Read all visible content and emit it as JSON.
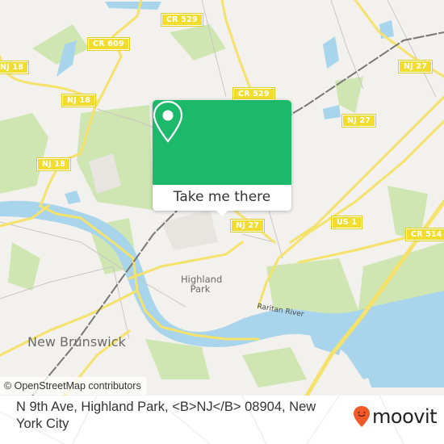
{
  "map": {
    "attribution": "© OpenStreetMap contributors",
    "road_shields": [
      {
        "id": "cr529-top",
        "label": "CR 529"
      },
      {
        "id": "cr609",
        "label": "CR 609"
      },
      {
        "id": "nj27-top",
        "label": "NJ 27"
      },
      {
        "id": "nj18-left",
        "label": "NJ 18"
      },
      {
        "id": "nj18-mid",
        "label": "NJ 18"
      },
      {
        "id": "cr529-mid",
        "label": "CR 529"
      },
      {
        "id": "nj27-mid",
        "label": "NJ 27"
      },
      {
        "id": "nj18-low",
        "label": "NJ 18"
      },
      {
        "id": "nj27-low",
        "label": "NJ 27"
      },
      {
        "id": "us1",
        "label": "US 1"
      },
      {
        "id": "cr514",
        "label": "CR 514"
      }
    ],
    "places": [
      {
        "id": "highland-park",
        "label": "Highland Park"
      },
      {
        "id": "new-brunswick",
        "label": "New Brunswick"
      }
    ],
    "water_labels": [
      {
        "id": "raritan-river",
        "label": "Raritan River"
      }
    ],
    "colors": {
      "land": "#f2f1ed",
      "park": "#c8e3a8",
      "water": "#a8d5ec",
      "road_major": "#f5e26b",
      "rail": "#777777",
      "popup_accent": "#1db96b"
    }
  },
  "popup": {
    "icon": "location-pin-icon",
    "button_label": "Take me there"
  },
  "footer": {
    "address": "N 9th Ave, Highland Park, <B>NJ</B> 08904, New York City",
    "brand": "moovit",
    "brand_icon": "moovit-pin-smile-icon",
    "brand_color": "#f05a28"
  }
}
